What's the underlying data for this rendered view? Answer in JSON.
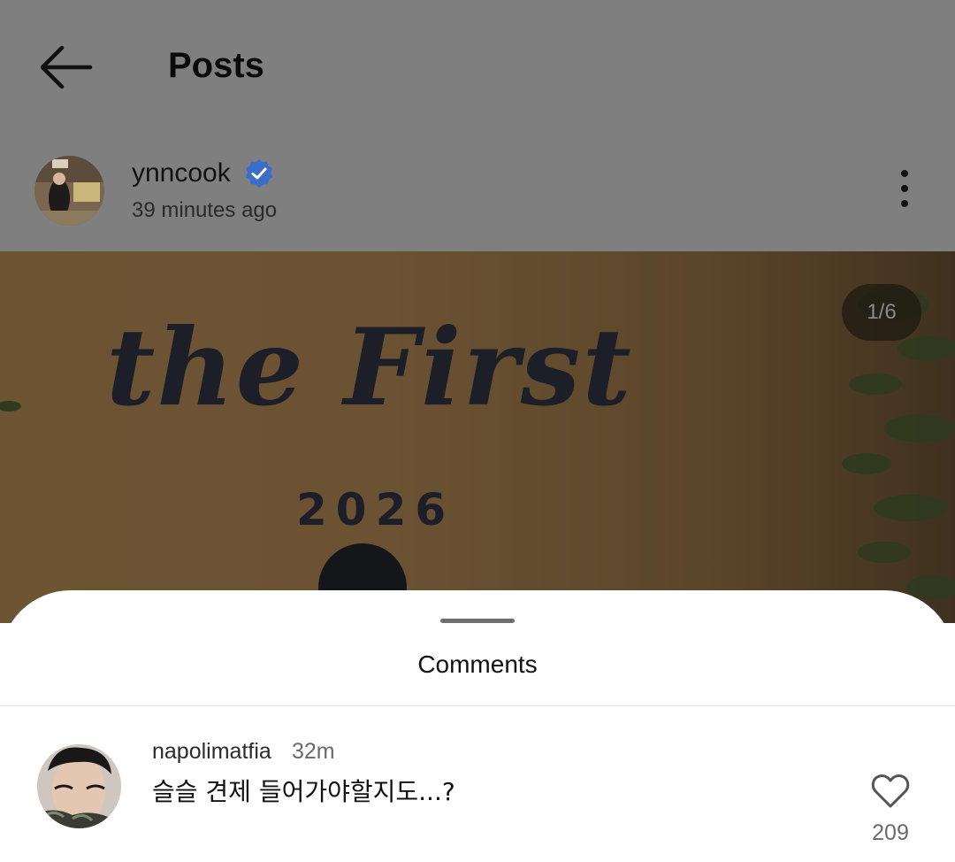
{
  "header": {
    "title": "Posts",
    "back_icon": "arrow-left-icon",
    "more_icon": "more-vertical-icon"
  },
  "post": {
    "username": "ynncook",
    "verified_icon": "verified-badge-icon",
    "verified_color": "#3b6ec9",
    "time_ago": "39 minutes ago",
    "page_indicator": "1/6",
    "image_title": "the First",
    "image_year": "2026"
  },
  "comments_sheet": {
    "title": "Comments",
    "comments": [
      {
        "username": "napolimatfia",
        "time": "32m",
        "text": "슬슬 견제 들어가야할지도...?",
        "like_icon": "heart-outline-icon",
        "likes": "209"
      }
    ]
  },
  "colors": {
    "overlay_dim": "#7f7f7f",
    "sheet_bg": "#ffffff"
  }
}
